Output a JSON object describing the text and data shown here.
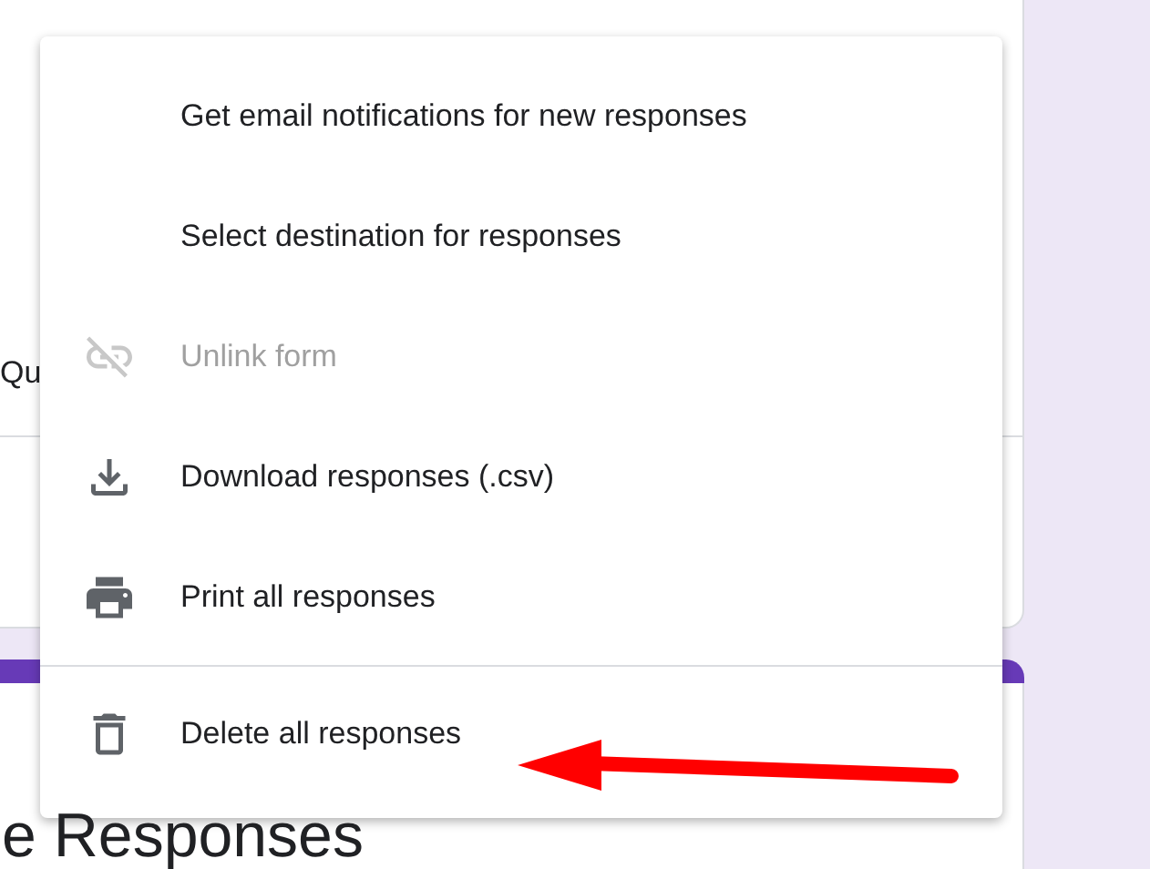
{
  "background": {
    "tab_label": "Qu",
    "heading": "e Responses"
  },
  "menu": {
    "items": [
      {
        "label": "Get email notifications for new responses",
        "disabled": false,
        "divider_before": false
      },
      {
        "label": "Select destination for responses",
        "disabled": false,
        "divider_before": false
      },
      {
        "label": "Unlink form",
        "disabled": true,
        "divider_before": false
      },
      {
        "label": "Download responses (.csv)",
        "disabled": false,
        "divider_before": false
      },
      {
        "label": "Print all responses",
        "disabled": false,
        "divider_before": false
      },
      {
        "label": "Delete all responses",
        "disabled": false,
        "divider_before": true
      }
    ]
  }
}
